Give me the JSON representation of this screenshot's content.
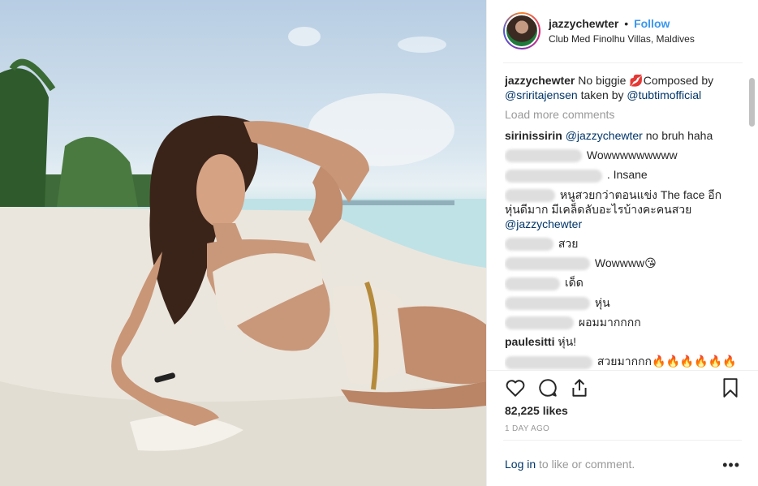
{
  "header": {
    "username": "jazzychewter",
    "separator": "•",
    "follow_label": "Follow",
    "location": "Club Med Finolhu Villas, Maldives"
  },
  "caption": {
    "author": "jazzychewter",
    "text_before": "No biggie",
    "emoji": "💋",
    "text_composed": "Composed by",
    "mention_1": "@sriritajensen",
    "text_taken": "taken by",
    "mention_2": "@tubtimofficial"
  },
  "load_more": "Load more comments",
  "comments": [
    {
      "author": "sirinissirin",
      "mention": "@jazzychewter",
      "text": "no bruh haha"
    },
    {
      "text": "Wowwwwwwwww"
    },
    {
      "text": ". Insane"
    },
    {
      "text": "หนูสวยกว่าตอนแข่ง The face อีก",
      "text2": "หุ่นดีมาก มีเคล็ดลับอะไรบ้างคะคนสวย",
      "mention": "@jazzychewter"
    },
    {
      "text": "สวย"
    },
    {
      "text": "Wowwww😘"
    },
    {
      "text": "เด็ด"
    },
    {
      "text": "หุ่น"
    },
    {
      "text": "ผอมมากกกก"
    },
    {
      "author": "paulesitti",
      "text": "หุ่น!"
    },
    {
      "text": "สวยมากกก🔥🔥🔥🔥🔥🔥"
    }
  ],
  "likes": "82,225 likes",
  "time_ago": "1 DAY AGO",
  "footer": {
    "login_link": "Log in",
    "login_text": "to like or comment.",
    "more": "•••"
  },
  "icons": {
    "like": "heart-icon",
    "comment": "comment-icon",
    "share": "share-icon",
    "save": "bookmark-icon",
    "more": "more-options-icon"
  },
  "colors": {
    "link_blue": "#3897f0",
    "mention_blue": "#003569",
    "muted": "#999999"
  }
}
